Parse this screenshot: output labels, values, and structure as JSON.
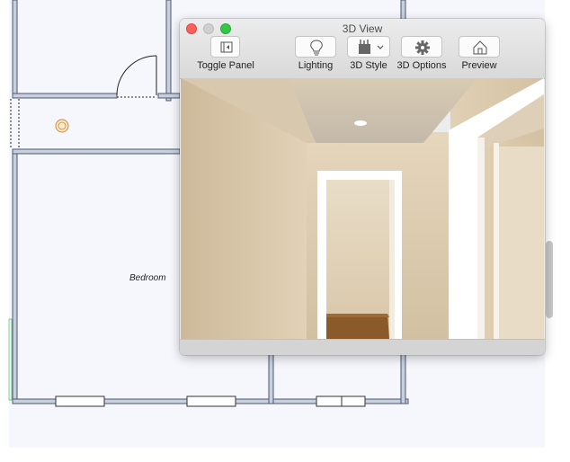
{
  "floorplan": {
    "room_label": "Bedroom",
    "fixture_icon": "ceiling-light-icon",
    "wall_color": "#7b8aa3",
    "background_color": "#f5f6fb"
  },
  "window": {
    "title": "3D View",
    "toolbar": {
      "toggle_panel": {
        "label": "Toggle Panel",
        "icon": "sidebar-toggle-icon"
      },
      "lighting": {
        "label": "Lighting",
        "icon": "lightbulb-icon"
      },
      "style_3d": {
        "label": "3D Style",
        "icon": "paint-brush-icon"
      },
      "options_3d": {
        "label": "3D Options",
        "icon": "gear-icon"
      },
      "preview": {
        "label": "Preview",
        "icon": "house-icon"
      }
    }
  },
  "colors": {
    "close": "#fc605c",
    "minimize_inactive": "#cfcfcf",
    "zoom": "#34c84a",
    "render_wall": "#d6c4a6",
    "render_ceiling": "#c9bfb0",
    "door_trim": "#ffffff",
    "floor_wood": "#8a5a2b"
  }
}
